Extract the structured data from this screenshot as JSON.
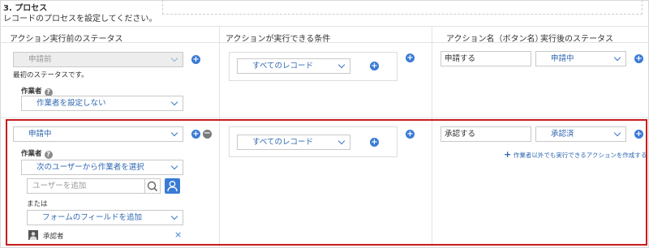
{
  "section": {
    "title": "3. プロセス",
    "description": "レコードのプロセスを設定してください。"
  },
  "columns": {
    "status_before": "アクション実行前のステータス",
    "condition": "アクションが実行できる条件",
    "action_name": "アクション名（ボタン名）",
    "status_after": "実行後のステータス"
  },
  "row1": {
    "status": "申請前",
    "status_note": "最初のステータスです。",
    "assignee_label": "作業者",
    "assignee_value": "作業者を設定しない",
    "condition": "すべてのレコード",
    "action_name": "申請する",
    "next_status": "申請中"
  },
  "row2": {
    "status": "申請中",
    "assignee_label": "作業者",
    "assignee_value": "次のユーザーから作業者を選択",
    "user_search_placeholder": "ユーザーを追加",
    "or_label": "または",
    "field_select": "フォームのフィールドを追加",
    "assignee_item": "承認者",
    "condition": "すべてのレコード",
    "action_name": "承認する",
    "next_status": "承認済",
    "add_other_action": "作業者以外でも実行できるアクションを作成する"
  },
  "icons": {
    "plus": "+",
    "minus": "−",
    "help": "?",
    "close": "×"
  }
}
